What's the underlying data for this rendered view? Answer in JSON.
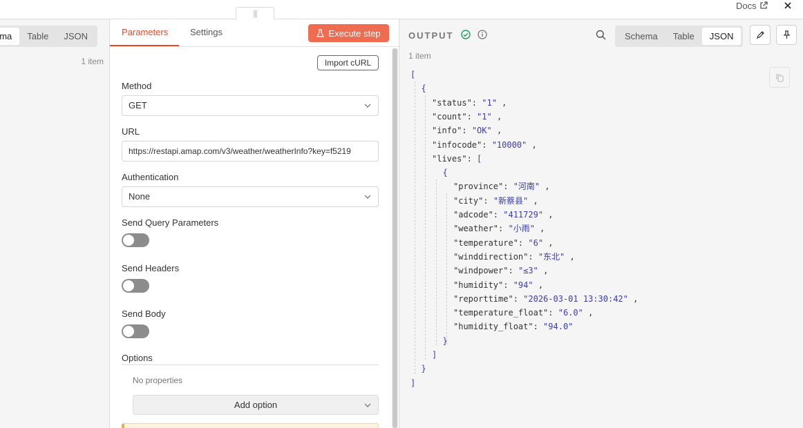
{
  "top": {
    "docs_label": "Docs"
  },
  "input_panel": {
    "views": [
      "ema",
      "Table",
      "JSON"
    ],
    "active_view": "ema",
    "item_count": "1 item"
  },
  "params": {
    "tabs": [
      "Parameters",
      "Settings"
    ],
    "active_tab": "Parameters",
    "execute_label": "Execute step",
    "import_curl_label": "Import cURL",
    "method": {
      "label": "Method",
      "value": "GET"
    },
    "url": {
      "label": "URL",
      "value": "https://restapi.amap.com/v3/weather/weatherInfo?key=f5219"
    },
    "authentication": {
      "label": "Authentication",
      "value": "None"
    },
    "send_query": {
      "label": "Send Query Parameters",
      "enabled": false
    },
    "send_headers": {
      "label": "Send Headers",
      "enabled": false
    },
    "send_body": {
      "label": "Send Body",
      "enabled": false
    },
    "options": {
      "label": "Options",
      "empty_text": "No properties",
      "add_label": "Add option"
    }
  },
  "output": {
    "title": "OUTPUT",
    "views": [
      "Schema",
      "Table",
      "JSON"
    ],
    "active_view": "JSON",
    "item_count": "1 item",
    "json_lines": [
      {
        "indent": 0,
        "text": "["
      },
      {
        "indent": 1,
        "text": "{"
      },
      {
        "indent": 2,
        "key": "status",
        "value": "1"
      },
      {
        "indent": 2,
        "key": "count",
        "value": "1"
      },
      {
        "indent": 2,
        "key": "info",
        "value": "OK"
      },
      {
        "indent": 2,
        "key": "infocode",
        "value": "10000"
      },
      {
        "indent": 2,
        "key": "lives",
        "open": "["
      },
      {
        "indent": 3,
        "text": "{"
      },
      {
        "indent": 4,
        "key": "province",
        "value": "河南"
      },
      {
        "indent": 4,
        "key": "city",
        "value": "新蔡县"
      },
      {
        "indent": 4,
        "key": "adcode",
        "value": "411729"
      },
      {
        "indent": 4,
        "key": "weather",
        "value": "小雨"
      },
      {
        "indent": 4,
        "key": "temperature",
        "value": "6"
      },
      {
        "indent": 4,
        "key": "winddirection",
        "value": "东北"
      },
      {
        "indent": 4,
        "key": "windpower",
        "value": "≤3"
      },
      {
        "indent": 4,
        "key": "humidity",
        "value": "94"
      },
      {
        "indent": 4,
        "key": "reporttime",
        "value": "2026-03-01 13:30:42"
      },
      {
        "indent": 4,
        "key": "temperature_float",
        "value": "6.0"
      },
      {
        "indent": 4,
        "key": "humidity_float",
        "value": "94.0",
        "last": true
      },
      {
        "indent": 3,
        "text": "}"
      },
      {
        "indent": 2,
        "text": "]"
      },
      {
        "indent": 1,
        "text": "}"
      },
      {
        "indent": 0,
        "text": "]"
      }
    ]
  },
  "colors": {
    "accent": "#ea4b28",
    "execute_bg": "#ef6c51",
    "json_string": "#3a3ab8",
    "success": "#1f9d55"
  },
  "icons": [
    "external-link-icon",
    "close-icon",
    "flask-icon",
    "chevron-down-icon",
    "success-icon",
    "info-icon",
    "search-icon",
    "pencil-icon",
    "pin-icon",
    "copy-icon"
  ]
}
